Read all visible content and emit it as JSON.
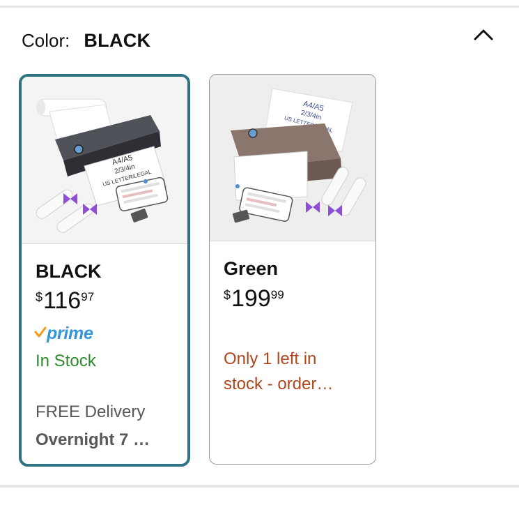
{
  "header": {
    "color_label": "Color:",
    "selected_color": "BLACK"
  },
  "icons": {
    "collapse": "chevron-up-icon",
    "prime_check": "check-icon"
  },
  "options": [
    {
      "name": "BLACK",
      "currency": "$",
      "price_whole": "116",
      "price_fraction": "97",
      "prime": "prime",
      "stock": "In Stock",
      "delivery_label": "FREE Delivery",
      "delivery_when": "Overnight 7 …",
      "image_text": [
        "A4/A5",
        "2/3/4in",
        "US LETTER/LEGAL"
      ],
      "selected": true
    },
    {
      "name": "Green",
      "currency": "$",
      "price_whole": "199",
      "price_fraction": "99",
      "stock_line1": "Only 1 left in",
      "stock_line2": "stock - order…",
      "image_text": [
        "A4/A5",
        "2/3/4in",
        "US LETTER/LEGAL"
      ],
      "selected": false
    }
  ],
  "colors": {
    "selected_border": "#2f7283",
    "in_stock": "#2f8a2f",
    "low_stock": "#b1461d",
    "prime_blue": "#3595d6",
    "prime_check": "#f59b1c"
  }
}
